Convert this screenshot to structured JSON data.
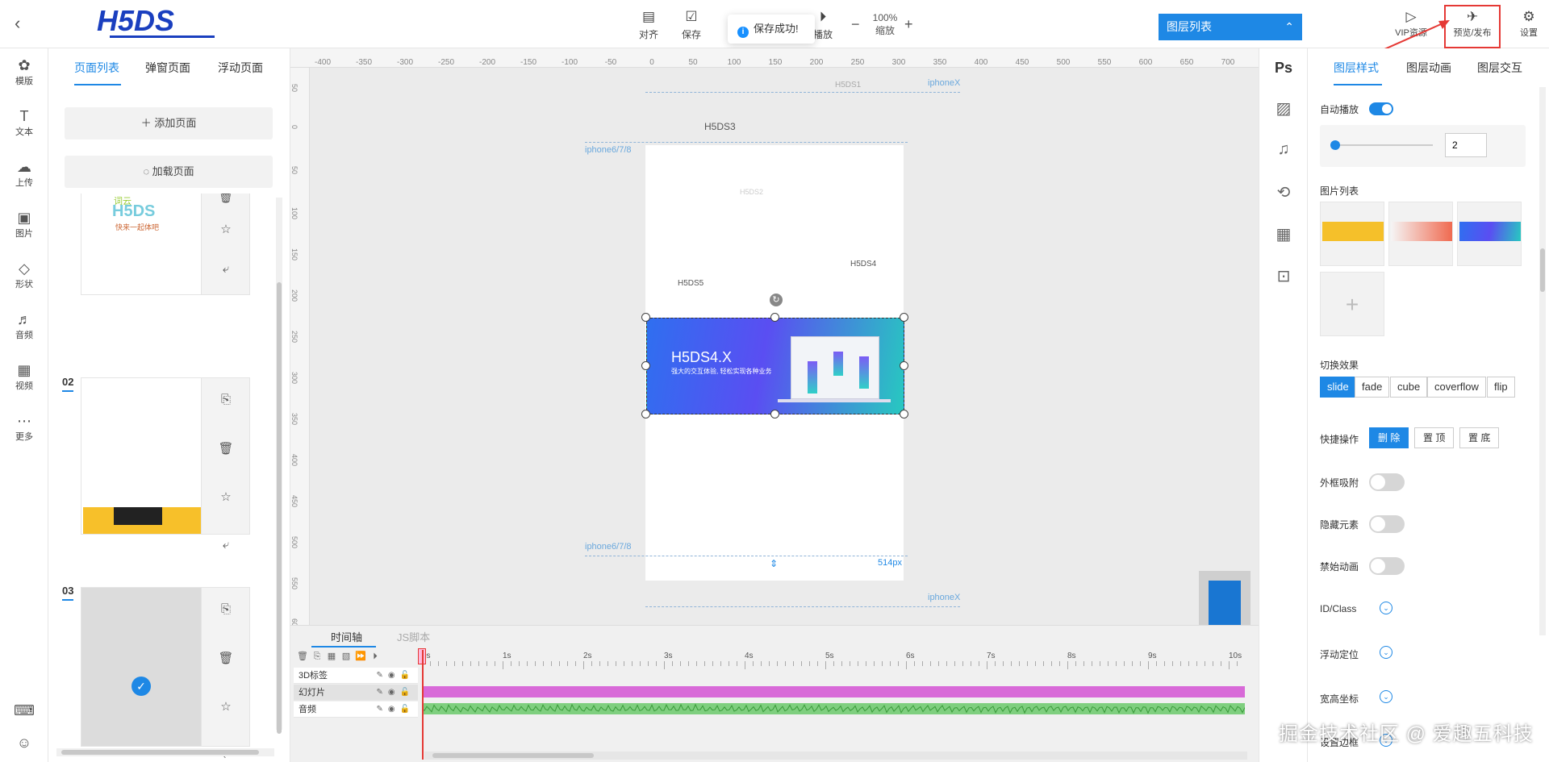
{
  "header": {
    "logo_text": "H5DS",
    "tools": [
      {
        "label": "对齐",
        "icon": "align-icon"
      },
      {
        "label": "保存",
        "icon": "save-icon"
      },
      {
        "label": "播放",
        "icon": "play-icon"
      }
    ],
    "zoom_value": "100%",
    "zoom_label": "缩放",
    "toast_text": "保存成功!",
    "layer_list_label": "图层列表",
    "vip_label": "VIP资源",
    "publish_label": "预览/发布",
    "settings_label": "设置"
  },
  "left_nav": [
    "模版",
    "文本",
    "上传",
    "图片",
    "形状",
    "音频",
    "视频",
    "更多"
  ],
  "page_panel": {
    "tabs": [
      "页面列表",
      "弹窗页面",
      "浮动页面"
    ],
    "add_page": "添加页面",
    "load_page": "加载页面",
    "page_numbers": [
      "02",
      "03"
    ],
    "thumb1_text": "H5DS",
    "thumb1_sub": "快来一起体吧",
    "thumb1_top": "词云"
  },
  "canvas": {
    "ruler_top": [
      "-400",
      "-350",
      "-300",
      "-250",
      "-200",
      "-150",
      "-100",
      "-50",
      "0",
      "50",
      "100",
      "150",
      "200",
      "250",
      "300",
      "350",
      "400",
      "450",
      "500",
      "550",
      "600",
      "650",
      "700",
      "75"
    ],
    "ruler_left": [
      "50",
      "0",
      "50",
      "100",
      "150",
      "200",
      "250",
      "300",
      "350",
      "400",
      "450",
      "500",
      "550",
      "600"
    ],
    "labels": {
      "iphonex_top": "iphoneX",
      "iphone678_top": "iphone6/7/8",
      "iphone678_bottom": "iphone6/7/8",
      "iphonex_bottom": "iphoneX"
    },
    "texts": {
      "h5ds1": "H5DS1",
      "h5ds3": "H5DS3",
      "h5ds2": "H5DS2",
      "h5ds4": "H5DS4",
      "h5ds5": "H5DS5"
    },
    "banner_title": "H5DS4.X",
    "banner_sub": "强大的交互体验, 轻松实现各种业务",
    "height_label": "514px"
  },
  "timeline": {
    "tabs": [
      "时间轴",
      "JS脚本"
    ],
    "layers": [
      "3D标签",
      "幻灯片",
      "音频"
    ],
    "times": [
      "0s",
      "1s",
      "2s",
      "3s",
      "4s",
      "5s",
      "6s",
      "7s",
      "8s",
      "9s",
      "10s"
    ]
  },
  "right_tabs": [
    "图层样式",
    "图层动画",
    "图层交互"
  ],
  "props": {
    "autoplay_label": "自动播放",
    "autoplay_on": true,
    "slider_value": "2",
    "image_list_label": "图片列表",
    "switch_effect_label": "切换效果",
    "effects": [
      "slide",
      "fade",
      "cube",
      "coverflow",
      "flip"
    ],
    "effect_selected": "slide",
    "quick_ops_label": "快捷操作",
    "quick_ops": [
      "删 除",
      "置 顶",
      "置 底"
    ],
    "snap_label": "外框吸附",
    "hide_label": "隐藏元素",
    "disable_anim_label": "禁始动画",
    "id_class_label": "ID/Class",
    "float_pos_label": "浮动定位",
    "size_coord_label": "宽高坐标",
    "setting_margin_label": "设置边框"
  },
  "watermark": "掘金技术社区 @ 爱趣五科技",
  "colors": {
    "accent": "#1e88e5",
    "highlight": "#e53935",
    "track_slide": "#d86ad8",
    "track_audio": "#66c166"
  }
}
